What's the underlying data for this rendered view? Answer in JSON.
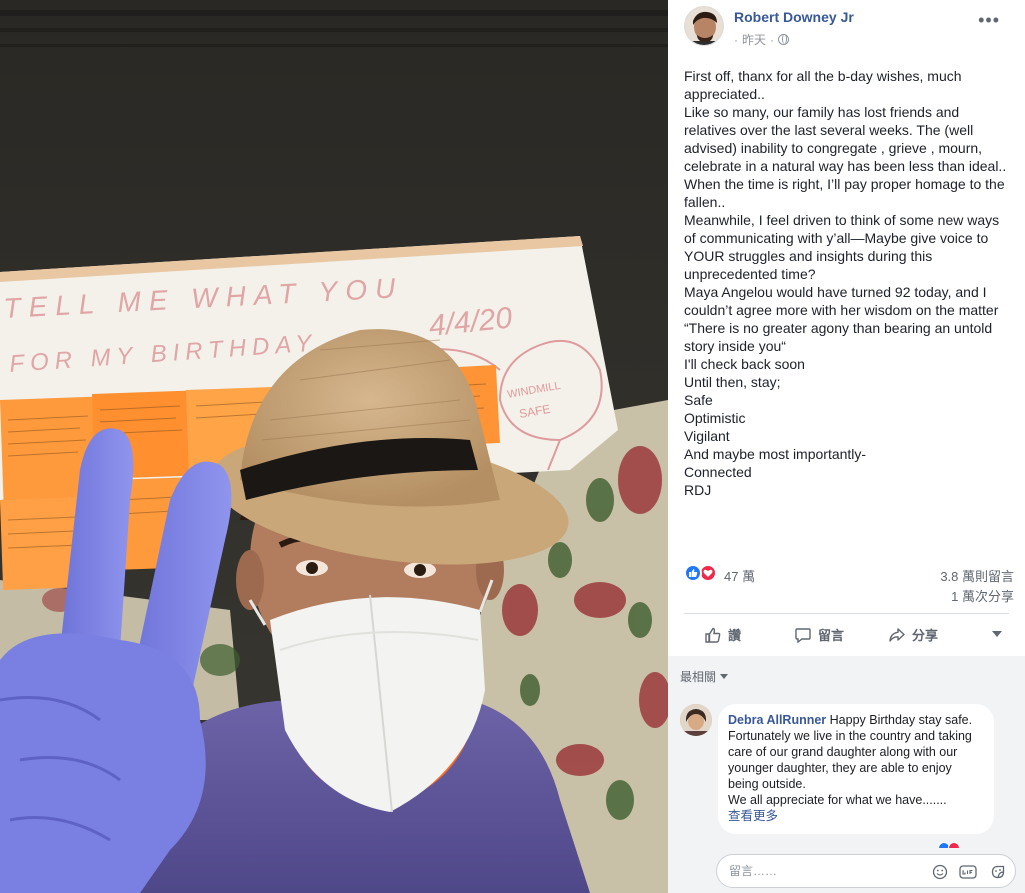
{
  "post": {
    "author": "Robert Downey Jr",
    "timestamp": "昨天",
    "separator": "·",
    "more_label": "•••",
    "body_lines": [
      "First off, thanx for all the b-day wishes, much appreciated..",
      "Like so many, our family has lost friends and relatives over the last several weeks. The (well advised) inability to congregate , grieve , mourn, celebrate in a natural way has been less than ideal..",
      "When the time is right, I’ll pay proper homage to the fallen..",
      "Meanwhile, I feel driven to think of some new ways of communicating with y’all—Maybe give voice to YOUR struggles and insights during this unprecedented time?",
      "Maya Angelou would have turned 92 today, and I couldn’t agree more with her wisdom on the matter “There is no greater agony than bearing an untold story inside you“",
      "I'll check back soon",
      "Until then, stay;",
      "Safe",
      "Optimistic",
      "Vigilant",
      "And maybe most importantly-",
      "Connected",
      "RDJ"
    ]
  },
  "stats": {
    "reactions": "47 萬",
    "comments": "3.8 萬則留言",
    "shares": "1 萬次分享"
  },
  "actions": {
    "like": "讚",
    "comment": "留言",
    "share": "分享"
  },
  "comments": {
    "sort_label": "最相關",
    "items": [
      {
        "name": "Debra AllRunner",
        "text_first": "Happy Birthday stay safe.",
        "text_rest": "Fortunately we live in the country and taking care of our grand daughter along with our younger daughter, they are able to enjoy being outside.",
        "text_last": "We all appreciate for what we have.......",
        "see_more": "查看更多"
      }
    ]
  },
  "composer": {
    "placeholder": "留言……"
  },
  "photo": {
    "whiteboard_lines": [
      "TELL ME WHAT YOU",
      "FOR MY BIRTHDAY",
      "4/4/20"
    ],
    "bubble_text": [
      "WINDMILL",
      "SAFE"
    ]
  },
  "colors": {
    "link": "#385898",
    "like": "#2078f4",
    "love": "#f0284a",
    "glove": "#7b82e6",
    "sticky": "#ff9a3c"
  }
}
